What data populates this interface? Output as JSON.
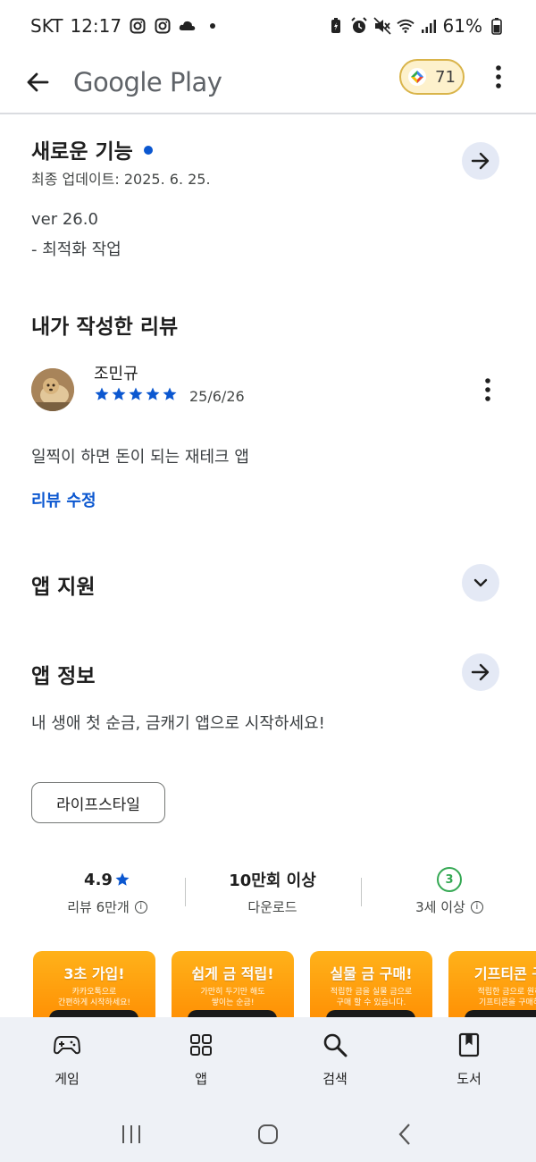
{
  "status_bar": {
    "carrier": "SKT",
    "time": "12:17",
    "battery": "61%"
  },
  "app_bar": {
    "brand": "Google Play",
    "points": "71"
  },
  "whats_new": {
    "title": "새로운 기능",
    "updated": "최종 업데이트: 2025. 6. 25.",
    "version": "ver 26.0",
    "note": "- 최적화 작업"
  },
  "my_review": {
    "title": "내가 작성한 리뷰",
    "reviewer": "조민규",
    "rating": 5,
    "date": "25/6/26",
    "text": "일찍이 하면 돈이 되는 재테크 앱",
    "edit_label": "리뷰 수정"
  },
  "app_support": {
    "title": "앱 지원"
  },
  "about_app": {
    "title": "앱 정보",
    "description": "내 생애 첫 순금, 금캐기 앱으로 시작하세요!",
    "category": "라이프스타일"
  },
  "stats": {
    "rating": "4.9",
    "reviews": "리뷰 6만개",
    "downloads": "10만회 이상",
    "downloads_label": "다운로드",
    "age_rating": "3",
    "age_label": "3세 이상"
  },
  "screenshots": [
    {
      "title": "3초 가입!",
      "desc": "카카오톡으로\n간편하게 시작하세요!"
    },
    {
      "title": "쉽게 금 적립!",
      "desc": "가만히 두기만 해도\n쌓이는 순금!"
    },
    {
      "title": "실물 금 구매!",
      "desc": "적립한 금을 실물 금으로\n구매 할 수 있습니다."
    },
    {
      "title": "기프티콘 구",
      "desc": "적립한 금으로 원하\n기프티콘을 구매하"
    }
  ],
  "bottom_nav": [
    {
      "label": "게임",
      "icon": "gamepad-icon"
    },
    {
      "label": "앱",
      "icon": "apps-grid-icon"
    },
    {
      "label": "검색",
      "icon": "search-icon"
    },
    {
      "label": "도서",
      "icon": "book-icon"
    }
  ],
  "colors": {
    "accent": "#0b57d0",
    "round_button_bg": "#e4e9f5",
    "nav_bg": "#eef1f6",
    "star": "#0b57d0",
    "shot_orange": "#ff9a0a"
  }
}
